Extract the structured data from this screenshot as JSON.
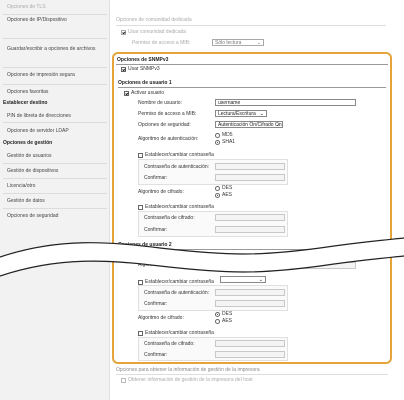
{
  "sidebar": {
    "items": [
      {
        "label": "Opciones de TLS"
      },
      {
        "label": "Opciones de IP/Dispositivo"
      },
      {
        "label": "Guardar/escribir a opciones de archivos"
      },
      {
        "label": "Opciones de impresión segura"
      },
      {
        "label": "Opciones favoritas"
      },
      {
        "label": "Establecer destino"
      },
      {
        "label": "PIN de libreta de direcciones"
      },
      {
        "label": "Opciones de servidor LDAP"
      },
      {
        "label": "Opciones de gestión"
      },
      {
        "label": "Gestión de usuarios"
      },
      {
        "label": "Gestión de dispositivos"
      },
      {
        "label": "Licencia/otro"
      },
      {
        "label": "Gestión de datos"
      },
      {
        "label": "Opciones de seguridad"
      }
    ]
  },
  "top": {
    "community_header": "Opciones de comunidad dedicada",
    "use_community_label": "Usar comunidad dedicada",
    "mib_access_label": "Permiso de acceso a MIB:",
    "mib_access_value": "Sólo lectura"
  },
  "snmpv3": {
    "header": "Opciones de SNMPv3",
    "use_label": "Usar SNMPv3",
    "user1": {
      "header": "Opciones de usuario 1",
      "enable_label": "Activar usuario",
      "username_label": "Nombre de usuario:",
      "username_value": "username",
      "mib_label": "Permiso de acceso a MIB:",
      "mib_value": "Lectura/Escritura",
      "security_label": "Opciones de seguridad:",
      "security_value": "Autenticación On/Cifrado On",
      "auth_algo_label": "Algoritmo de autenticación:",
      "auth_opt_md5": "MD5",
      "auth_opt_sha1": "SHA1",
      "set_auth_pw_label": "Establecer/cambiar contraseña",
      "auth_pw_label": "Contraseña de autenticación:",
      "confirm_label": "Confirmar:",
      "enc_algo_label": "Algoritmo de cifrado:",
      "enc_opt_des": "DES",
      "enc_opt_aes": "AES",
      "set_enc_pw_label": "Establecer/cambiar contraseña",
      "enc_pw_label": "Contraseña de cifrado:",
      "confirm2_label": "Confirmar:"
    },
    "user2": {
      "header": "Opciones de usuario 2",
      "algo_partial_label": "Algoritmo",
      "set_auth_pw_label": "Establecer/cambiar contraseña",
      "auth_pw_label": "Contraseña de autenticación:",
      "confirm_label": "Confirmar:",
      "enc_algo_label": "Algoritmo de cifrado:",
      "enc_opt_des": "DES",
      "enc_opt_aes": "AES",
      "set_enc_pw_label": "Establecer/cambiar contraseña",
      "enc_pw_label": "Contraseña de cifrado:",
      "confirm2_label": "Confirmar:"
    }
  },
  "bottom": {
    "printer_mgmt_header": "Opciones para obtener la información de gestión de la impresora",
    "printer_mgmt_checkbox": "Obtener información de gestión de la impresora del host"
  },
  "colors": {
    "highlight": "#e5a33a",
    "sidebar_bg": "#f2f2f2"
  }
}
